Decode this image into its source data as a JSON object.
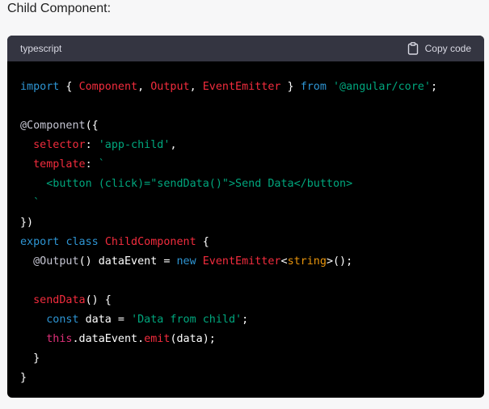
{
  "heading": "Child Component:",
  "code_block": {
    "language": "typescript",
    "copy_label": "Copy code",
    "copy_icon": "clipboard-icon",
    "lines": [
      [
        {
          "t": "import",
          "c": "kw"
        },
        {
          "t": " { ",
          "c": "white"
        },
        {
          "t": "Component",
          "c": "red"
        },
        {
          "t": ", ",
          "c": "white"
        },
        {
          "t": "Output",
          "c": "red"
        },
        {
          "t": ", ",
          "c": "white"
        },
        {
          "t": "EventEmitter",
          "c": "red"
        },
        {
          "t": " } ",
          "c": "white"
        },
        {
          "t": "from",
          "c": "kw"
        },
        {
          "t": " ",
          "c": "white"
        },
        {
          "t": "'@angular/core'",
          "c": "str"
        },
        {
          "t": ";",
          "c": "white"
        }
      ],
      [],
      [
        {
          "t": "@Component",
          "c": "gray"
        },
        {
          "t": "({",
          "c": "white"
        }
      ],
      [
        {
          "t": "  ",
          "c": "white"
        },
        {
          "t": "selector",
          "c": "red"
        },
        {
          "t": ": ",
          "c": "white"
        },
        {
          "t": "'app-child'",
          "c": "str"
        },
        {
          "t": ",",
          "c": "white"
        }
      ],
      [
        {
          "t": "  ",
          "c": "white"
        },
        {
          "t": "template",
          "c": "red"
        },
        {
          "t": ": ",
          "c": "white"
        },
        {
          "t": "`",
          "c": "str"
        }
      ],
      [
        {
          "t": "    <button (click)=\"sendData()\">Send Data</button>",
          "c": "str"
        }
      ],
      [
        {
          "t": "  `",
          "c": "str"
        }
      ],
      [
        {
          "t": "})",
          "c": "white"
        }
      ],
      [
        {
          "t": "export",
          "c": "kw"
        },
        {
          "t": " ",
          "c": "white"
        },
        {
          "t": "class",
          "c": "kw"
        },
        {
          "t": " ",
          "c": "white"
        },
        {
          "t": "ChildComponent",
          "c": "red"
        },
        {
          "t": " {",
          "c": "white"
        }
      ],
      [
        {
          "t": "  ",
          "c": "white"
        },
        {
          "t": "@Output",
          "c": "gray"
        },
        {
          "t": "() dataEvent = ",
          "c": "white"
        },
        {
          "t": "new",
          "c": "kw"
        },
        {
          "t": " ",
          "c": "white"
        },
        {
          "t": "EventEmitter",
          "c": "red"
        },
        {
          "t": "<",
          "c": "white"
        },
        {
          "t": "string",
          "c": "type"
        },
        {
          "t": ">();",
          "c": "white"
        }
      ],
      [],
      [
        {
          "t": "  ",
          "c": "white"
        },
        {
          "t": "sendData",
          "c": "red"
        },
        {
          "t": "() {",
          "c": "white"
        }
      ],
      [
        {
          "t": "    ",
          "c": "white"
        },
        {
          "t": "const",
          "c": "kw"
        },
        {
          "t": " data = ",
          "c": "white"
        },
        {
          "t": "'Data from child'",
          "c": "str"
        },
        {
          "t": ";",
          "c": "white"
        }
      ],
      [
        {
          "t": "    ",
          "c": "white"
        },
        {
          "t": "this",
          "c": "orange"
        },
        {
          "t": ".dataEvent.",
          "c": "white"
        },
        {
          "t": "emit",
          "c": "red"
        },
        {
          "t": "(data);",
          "c": "white"
        }
      ],
      [
        {
          "t": "  }",
          "c": "white"
        }
      ],
      [
        {
          "t": "}",
          "c": "white"
        }
      ]
    ]
  }
}
